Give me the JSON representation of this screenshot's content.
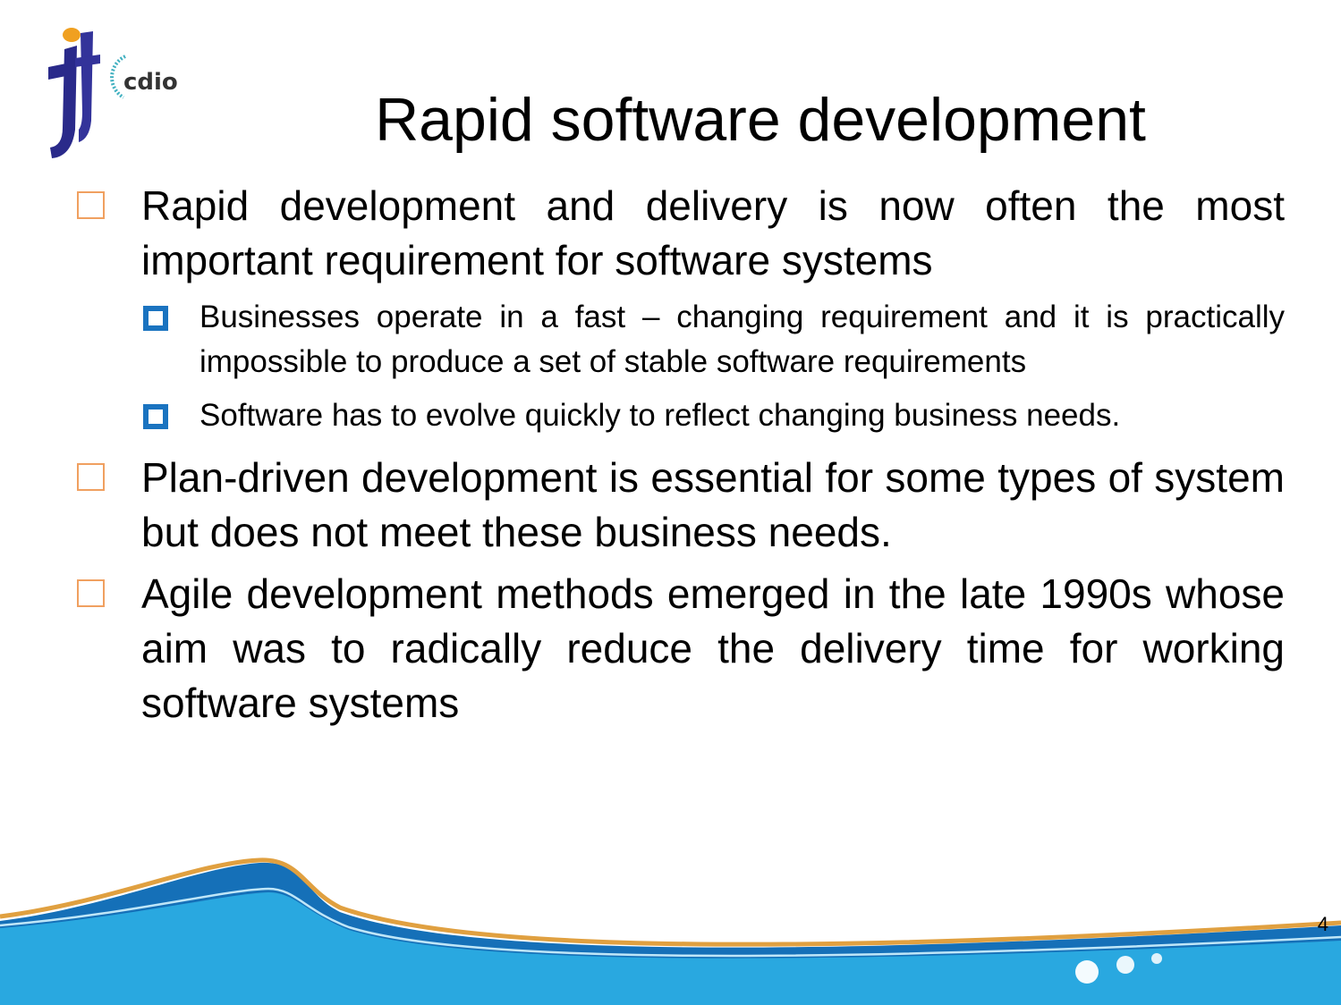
{
  "logo": {
    "primary": "jit",
    "secondary": "cdio"
  },
  "title": "Rapid software development",
  "bullets": [
    {
      "text": "Rapid development and delivery is now often the most important requirement for software systems",
      "sub": [
        {
          "text": "Businesses operate in a fast – changing requirement and it is practically impossible to produce a set of stable software requirements"
        },
        {
          "text": "Software has to evolve quickly to reflect changing business needs."
        }
      ]
    },
    {
      "text": "Plan-driven development is essential for some types of system but does not meet these business needs."
    },
    {
      "text": "Agile development methods emerged in the late 1990s whose aim was to radically reduce the delivery time for working software systems"
    }
  ],
  "page_number": "4",
  "colors": {
    "level1_bullet": "#f0a060",
    "level2_bullet": "#1a73c0",
    "wave_light": "#29a8e0",
    "wave_dark": "#1570b8",
    "wave_gold": "#e0a040"
  }
}
